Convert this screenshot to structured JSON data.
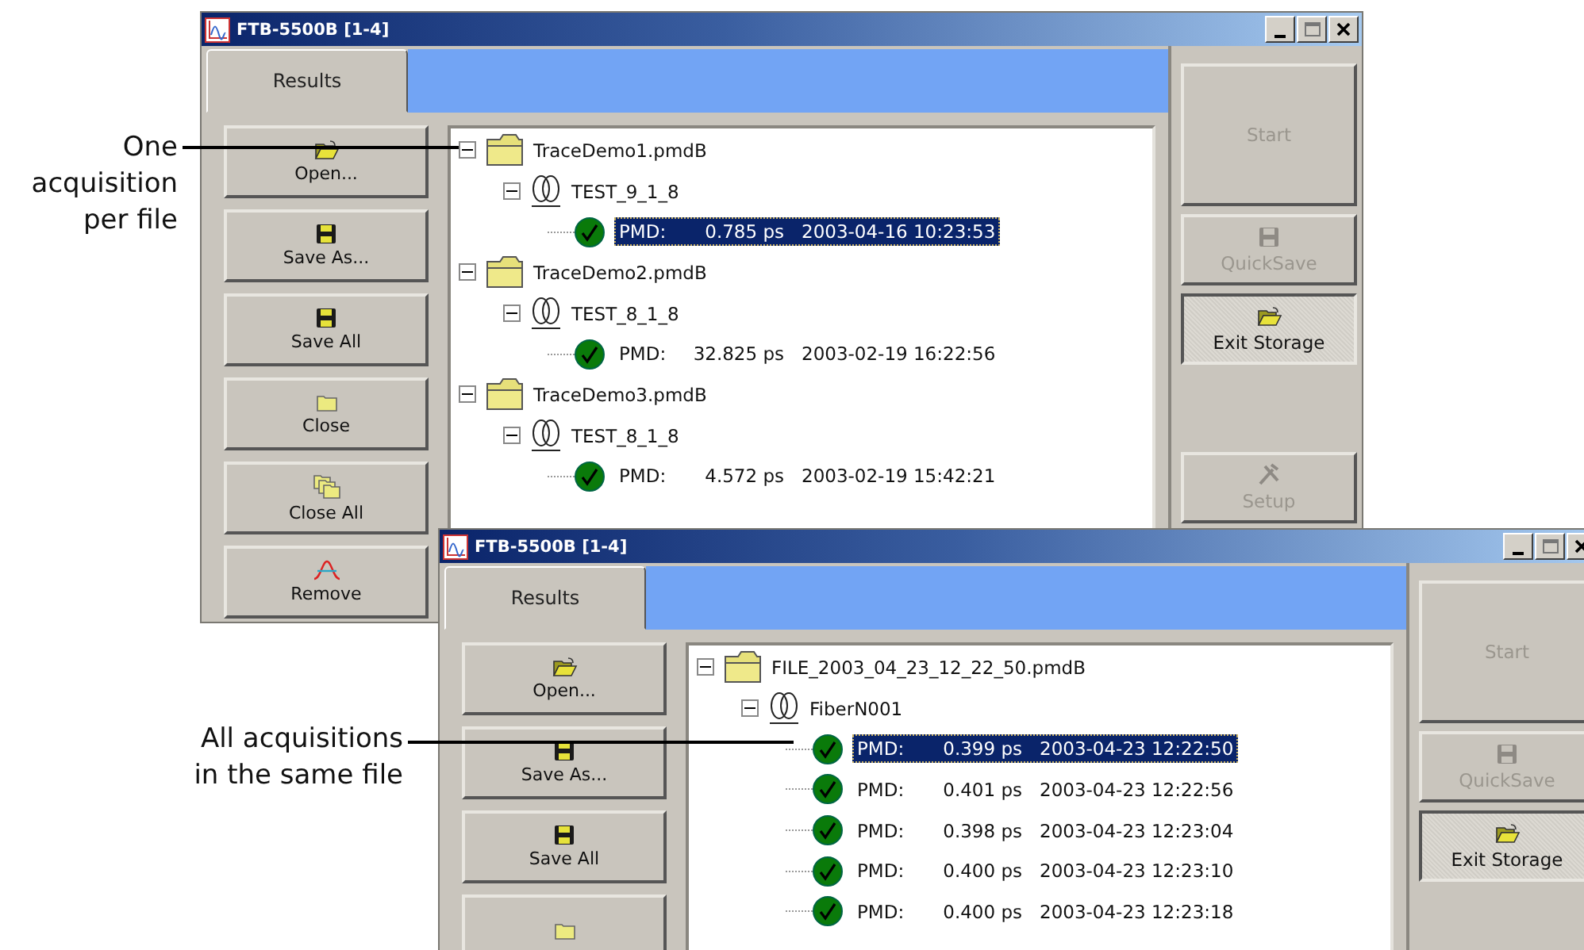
{
  "callouts": [
    {
      "text": "One\nacquisition\nper file"
    },
    {
      "text": "All acquisitions\nin the same file"
    }
  ],
  "windows": [
    {
      "title": "FTB-5500B [1-4]",
      "tabs": [
        {
          "label": "Results",
          "selected": true
        }
      ],
      "side_buttons": [
        {
          "label": "Open...",
          "kind": "open"
        },
        {
          "label": "Save As...",
          "kind": "save"
        },
        {
          "label": "Save All",
          "kind": "save"
        },
        {
          "label": "Close",
          "kind": "close"
        },
        {
          "label": "Close All",
          "kind": "closeall"
        },
        {
          "label": "Remove",
          "kind": "remove"
        }
      ],
      "tree": [
        {
          "kind": "file",
          "label": "TraceDemo1.pmdB",
          "expanded": true,
          "children": [
            {
              "kind": "fiber",
              "label": "TEST_9_1_8",
              "expanded": true,
              "children": [
                {
                  "kind": "result",
                  "label": "PMD:",
                  "value": "0.785 ps",
                  "date": "2003-04-16 10:23:53",
                  "selected": true
                }
              ]
            }
          ]
        },
        {
          "kind": "file",
          "label": "TraceDemo2.pmdB",
          "expanded": true,
          "children": [
            {
              "kind": "fiber",
              "label": "TEST_8_1_8",
              "expanded": true,
              "children": [
                {
                  "kind": "result",
                  "label": "PMD:",
                  "value": "32.825 ps",
                  "date": "2003-02-19 16:22:56",
                  "selected": false
                }
              ]
            }
          ]
        },
        {
          "kind": "file",
          "label": "TraceDemo3.pmdB",
          "expanded": true,
          "children": [
            {
              "kind": "fiber",
              "label": "TEST_8_1_8",
              "expanded": true,
              "children": [
                {
                  "kind": "result",
                  "label": "PMD:",
                  "value": "4.572 ps",
                  "date": "2003-02-19 15:42:21",
                  "selected": false
                }
              ]
            }
          ]
        }
      ],
      "right_buttons": [
        {
          "label": "Start",
          "kind": "start",
          "disabled": true,
          "pressed": false
        },
        {
          "label": "QuickSave",
          "kind": "save",
          "disabled": true,
          "pressed": false
        },
        {
          "label": "Exit Storage",
          "kind": "open",
          "disabled": false,
          "pressed": true
        },
        {
          "label": "Setup",
          "kind": "setup",
          "disabled": true,
          "pressed": false
        }
      ]
    },
    {
      "title": "FTB-5500B [1-4]",
      "tabs": [
        {
          "label": "Results",
          "selected": true
        }
      ],
      "side_buttons": [
        {
          "label": "Open...",
          "kind": "open"
        },
        {
          "label": "Save As...",
          "kind": "save"
        },
        {
          "label": "Save All",
          "kind": "save"
        },
        {
          "kind": "close"
        }
      ],
      "tree": [
        {
          "kind": "file",
          "label": "FILE_2003_04_23_12_22_50.pmdB",
          "expanded": true,
          "children": [
            {
              "kind": "fiber",
              "label": "FiberN001",
              "expanded": true,
              "children": [
                {
                  "kind": "result",
                  "label": "PMD:",
                  "value": "0.399 ps",
                  "date": "2003-04-23 12:22:50",
                  "selected": true
                },
                {
                  "kind": "result",
                  "label": "PMD:",
                  "value": "0.401 ps",
                  "date": "2003-04-23 12:22:56",
                  "selected": false
                },
                {
                  "kind": "result",
                  "label": "PMD:",
                  "value": "0.398 ps",
                  "date": "2003-04-23 12:23:04",
                  "selected": false
                },
                {
                  "kind": "result",
                  "label": "PMD:",
                  "value": "0.400 ps",
                  "date": "2003-04-23 12:23:10",
                  "selected": false
                },
                {
                  "kind": "result",
                  "label": "PMD:",
                  "value": "0.400 ps",
                  "date": "2003-04-23 12:23:18",
                  "selected": false
                }
              ]
            }
          ]
        }
      ],
      "right_buttons": [
        {
          "label": "Start",
          "kind": "start",
          "disabled": true,
          "pressed": false
        },
        {
          "label": "QuickSave",
          "kind": "save",
          "disabled": true,
          "pressed": false
        },
        {
          "label": "Exit Storage",
          "kind": "open",
          "disabled": false,
          "pressed": true
        }
      ]
    }
  ]
}
